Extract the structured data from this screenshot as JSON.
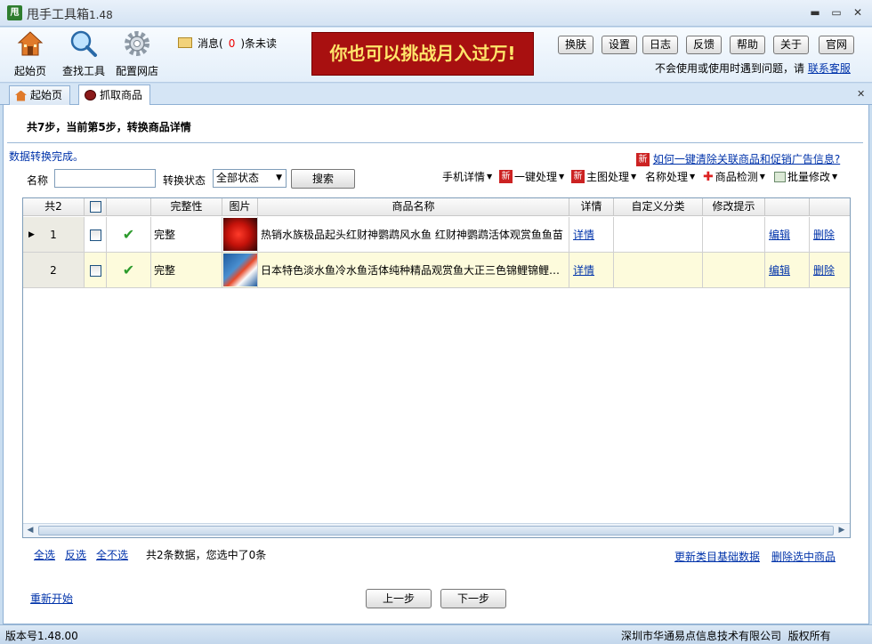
{
  "window": {
    "title": "甩手工具箱",
    "version": "1.48",
    "app_icon_text": "甩",
    "minimize": "▬",
    "maximize": "▭",
    "close": "✕"
  },
  "toolbar": {
    "home_label": "起始页",
    "find_tools_label": "查找工具",
    "config_shop_label": "配置网店",
    "message_prefix": "消息(",
    "message_count": "0",
    "message_suffix": ")条未读",
    "banner_text": "你也可以挑战月入过万!",
    "buttons": [
      "换肤",
      "设置",
      "日志",
      "反馈",
      "帮助",
      "关于",
      "官网"
    ],
    "help_note": "不会使用或使用时遇到问题，请",
    "support_link": "联系客服"
  },
  "tabs": [
    {
      "label": "起始页"
    },
    {
      "label": "抓取商品"
    }
  ],
  "tab_close": "✕",
  "steps_text": "共7步，当前第5步，转换商品详情",
  "status_message": "数据转换完成。",
  "clear_link": "如何一键清除关联商品和促销广告信息?",
  "new_badge": "新",
  "filter": {
    "name_label": "名称",
    "name_value": "",
    "status_label": "转换状态",
    "status_value": "全部状态",
    "search_button": "搜索"
  },
  "actions": [
    "手机详情",
    "一键处理",
    "主图处理",
    "名称处理",
    "商品检测",
    "批量修改"
  ],
  "table": {
    "headers": {
      "count": "共2",
      "completeness": "完整性",
      "image": "图片",
      "name": "商品名称",
      "detail": "详情",
      "custom_category": "自定义分类",
      "edit_hint": "修改提示"
    },
    "rows": [
      {
        "num": "1",
        "completeness": "完整",
        "name": "热销水族极品起头红财神鹦鹉风水鱼 红财神鹦鹉活体观赏鱼鱼苗",
        "detail": "详情",
        "custom_category": "",
        "edit_hint": "",
        "edit": "编辑",
        "delete": "删除"
      },
      {
        "num": "2",
        "completeness": "完整",
        "name": "日本特色淡水鱼冷水鱼活体纯种精品观赏鱼大正三色锦鲤锦鲤…",
        "detail": "详情",
        "custom_category": "",
        "edit_hint": "",
        "edit": "编辑",
        "delete": "删除"
      }
    ]
  },
  "bottom": {
    "select_all": "全选",
    "invert": "反选",
    "select_none": "全不选",
    "summary": "共2条数据，您选中了0条",
    "update_category": "更新类目基础数据",
    "delete_selected": "删除选中商品",
    "restart": "重新开始",
    "prev": "上一步",
    "next": "下一步"
  },
  "statusbar": {
    "version": "版本号1.48.00",
    "copyright": "深圳市华通易点信息技术有限公司  版权所有"
  },
  "colors": {
    "accent": "#0033aa",
    "banner_bg": "#a81010",
    "banner_text": "#ffe56a",
    "row_highlight": "#fdfbdc",
    "check_green": "#2c9b2c"
  }
}
